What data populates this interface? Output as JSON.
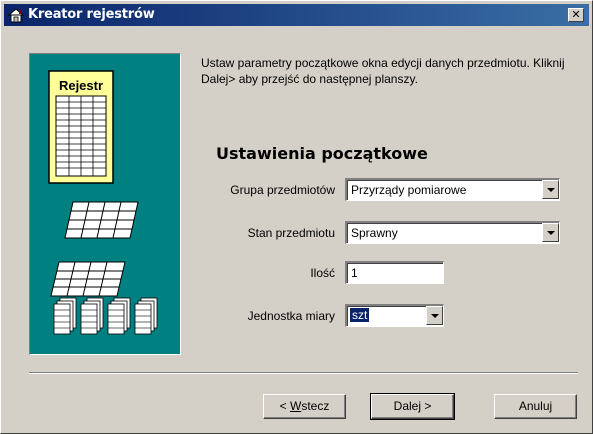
{
  "window": {
    "title": "Kreator rejestrów",
    "close_glyph": "✕"
  },
  "art": {
    "card_title": "Rejestr",
    "icons": [
      "register-card",
      "table-sheet",
      "table-sheet",
      "stacked-cards"
    ]
  },
  "instructions": "Ustaw parametry początkowe okna edycji danych przedmiotu. Kliknij Dalej> aby przejść do następnej planszy.",
  "section_title": "Ustawienia początkowe",
  "form": {
    "group": {
      "label": "Grupa przedmiotów",
      "value": "Przyrządy pomiarowe"
    },
    "state": {
      "label": "Stan przedmiotu",
      "value": "Sprawny"
    },
    "quantity": {
      "label": "Ilość",
      "value": "1"
    },
    "unit": {
      "label": "Jednostka miary",
      "value": "szt"
    }
  },
  "buttons": {
    "back_prefix": "< ",
    "back_mnemonic": "W",
    "back_rest": "stecz",
    "next": "Dalej >",
    "cancel": "Anuluj"
  }
}
